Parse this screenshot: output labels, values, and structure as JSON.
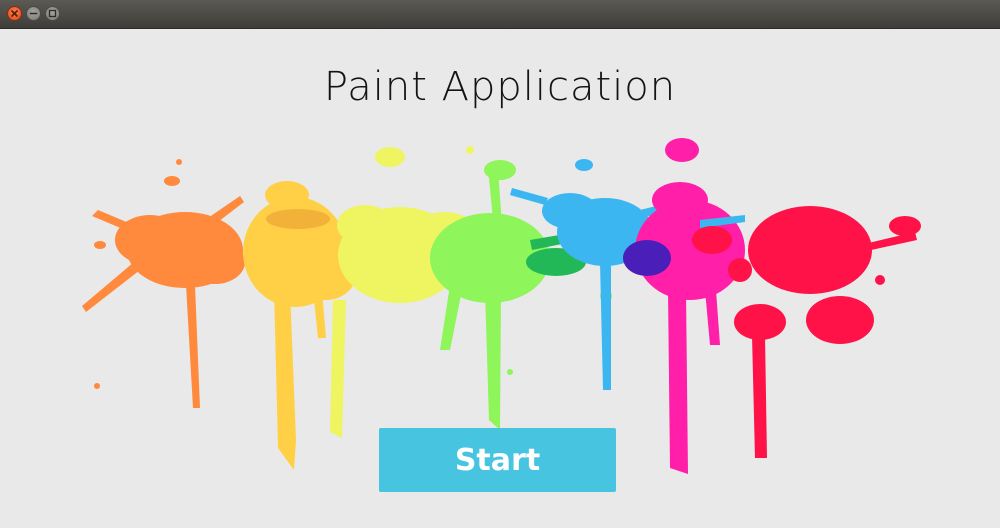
{
  "window": {
    "title_bar_buttons": [
      "close-icon",
      "minimize-icon",
      "maximize-icon"
    ]
  },
  "app": {
    "title": "Paint Application",
    "start_label": "Start"
  },
  "colors": {
    "start_button": "#46c4e0",
    "splash": [
      "#ff8a3d",
      "#ffd046",
      "#eef560",
      "#8ef55a",
      "#3cb6f0",
      "#ff1fa8",
      "#ff1248"
    ]
  }
}
